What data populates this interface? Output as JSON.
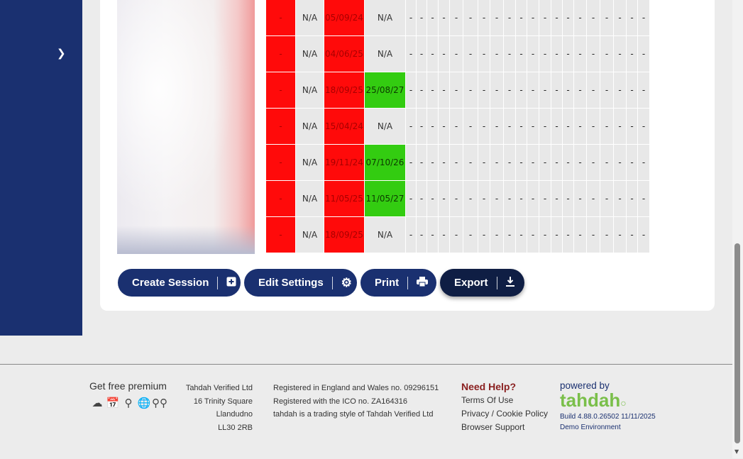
{
  "table": {
    "rows": [
      {
        "c1": "-",
        "c2": "N/A",
        "c3": "05/09/24",
        "c4": "N/A",
        "c4_green": false
      },
      {
        "c1": "-",
        "c2": "N/A",
        "c3": "04/06/25",
        "c4": "N/A",
        "c4_green": false
      },
      {
        "c1": "-",
        "c2": "N/A",
        "c3": "18/09/25",
        "c4": "25/08/27",
        "c4_green": true
      },
      {
        "c1": "-",
        "c2": "N/A",
        "c3": "15/04/24",
        "c4": "N/A",
        "c4_green": false
      },
      {
        "c1": "-",
        "c2": "N/A",
        "c3": "19/11/24",
        "c4": "07/10/26",
        "c4_green": true
      },
      {
        "c1": "-",
        "c2": "N/A",
        "c3": "11/05/25",
        "c4": "11/05/27",
        "c4_green": true
      },
      {
        "c1": "-",
        "c2": "N/A",
        "c3": "18/09/25",
        "c4": "N/A",
        "c4_green": false
      }
    ],
    "dash_cell": "-"
  },
  "toolbar": {
    "create_session": "Create Session",
    "edit_settings": "Edit Settings",
    "print": "Print",
    "export": "Export"
  },
  "footer": {
    "premium": "Get free premium",
    "address": [
      "Tahdah Verified Ltd",
      "16 Trinity Square",
      "Llandudno",
      "LL30 2RB"
    ],
    "registration": [
      "Registered in England and Wales no. 09296151",
      "Registered with the ICO no. ZA164316",
      "tahdah is a trading style of Tahdah Verified Ltd"
    ],
    "help_title": "Need Help?",
    "links": [
      "Terms Of Use",
      "Privacy / Cookie Policy",
      "Browser Support"
    ],
    "powered_by": "powered by",
    "logo": "tahdah",
    "build": "Build 4.88.0.26502 11/11/2025",
    "environment": "Demo Environment"
  },
  "colors": {
    "navy": "#1a3070",
    "red": "#ff0a0a",
    "green": "#33cc11",
    "logo_green": "#7abf4a"
  },
  "icons": [
    "cloud-icon",
    "calendar-icon",
    "map-pin-icon",
    "globe-icon",
    "glasses-icon"
  ]
}
